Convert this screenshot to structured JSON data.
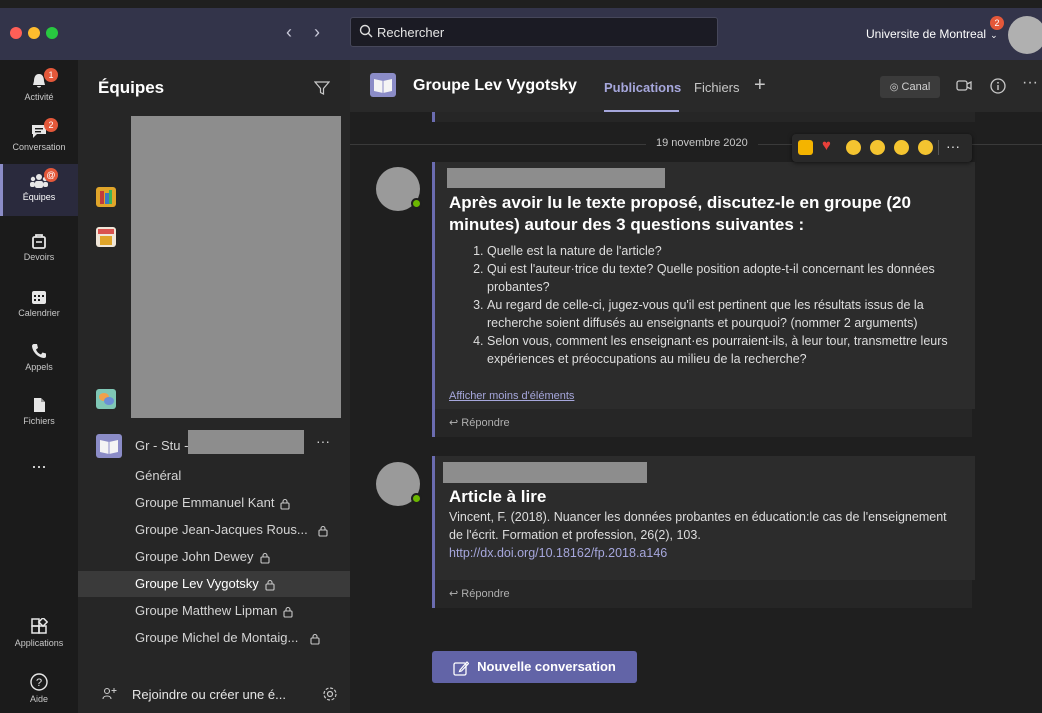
{
  "search": {
    "placeholder": "Rechercher"
  },
  "org": {
    "name": "Universite de Montreal",
    "badge": "2"
  },
  "rail": {
    "items": [
      {
        "label": "Activité",
        "badge": "1"
      },
      {
        "label": "Conversation",
        "badge": "2"
      },
      {
        "label": "Équipes",
        "badge": "@"
      },
      {
        "label": "Devoirs"
      },
      {
        "label": "Calendrier"
      },
      {
        "label": "Appels"
      },
      {
        "label": "Fichiers"
      },
      {
        "label": "..."
      }
    ],
    "apps_label": "Applications",
    "help_label": "Aide"
  },
  "teams": {
    "title": "Équipes",
    "team_name": "Gr - Stu -",
    "more": "···",
    "channels": [
      "Général",
      "Groupe Emmanuel Kant",
      "Groupe Jean-Jacques Rous...",
      "Groupe John Dewey",
      "Groupe Lev Vygotsky",
      "Groupe Matthew Lipman",
      "Groupe Michel de Montaig..."
    ],
    "join_label": "Rejoindre ou créer une é..."
  },
  "header": {
    "title": "Groupe Lev Vygotsky",
    "tab_publications": "Publications",
    "tab_fichiers": "Fichiers",
    "tab_add": "+",
    "canal_label": "Canal"
  },
  "feed": {
    "prev_reply": "Répondre",
    "date": "19 novembre 2020",
    "post1": {
      "title": "Après avoir lu le texte proposé, discutez-le en groupe (20 minutes) autour des 3 questions suivantes :",
      "questions": [
        "Quelle est la nature de l'article?",
        "Qui est l'auteur·trice du texte? Quelle position adopte-t-il concernant les données probantes?",
        "Au regard de celle-ci, jugez-vous qu'il est pertinent que les résultats issus de la recherche soient diffusés au enseignants et pourquoi? (nommer 2 arguments)",
        "Selon vous, comment les enseignant·es pourraient-ils, à leur tour, transmettre leurs expériences et préoccupations au milieu de la recherche?"
      ],
      "show_less": "Afficher moins d'éléments",
      "reply": "Répondre"
    },
    "post2": {
      "title": "Article à lire",
      "body": "Vincent, F. (2018). Nuancer les données probantes en éducation:le cas de l'enseignement de l'écrit. Formation et profession, 26(2), 103.",
      "link": "http://dx.doi.org/10.18162/fp.2018.a146",
      "reply": "Répondre"
    },
    "new_conversation": "Nouvelle conversation"
  },
  "colors": {
    "accent": "#6264a7",
    "badge": "#e4583a",
    "topbar": "#33344a"
  }
}
